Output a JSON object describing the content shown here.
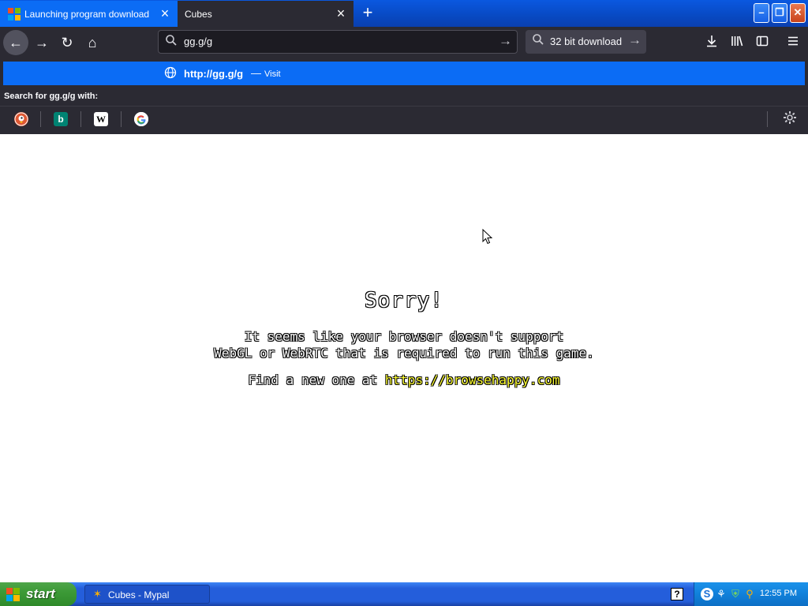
{
  "browser": {
    "tabs": [
      {
        "title": "Launching program download Wind",
        "active": true
      },
      {
        "title": "Cubes",
        "active": false
      }
    ],
    "new_tab_label": "+",
    "window_controls": {
      "minimize": "–",
      "restore": "❐",
      "close": "✕"
    },
    "nav": {
      "back": "←",
      "forward": "→",
      "reload": "↻",
      "home": "⌂"
    },
    "url_input_value": "gg.g/g",
    "search_bar_text": "32 bit download",
    "toolbar_icons": [
      "download-icon",
      "library-icon",
      "sidebar-icon",
      "menu-icon"
    ]
  },
  "dropdown": {
    "suggestion_url": "http://gg.g/g",
    "suggestion_sep": "—",
    "suggestion_action": "Visit",
    "search_with_label": "Search for gg.g/g with:",
    "engines": [
      "DuckDuckGo",
      "Bing",
      "Wikipedia",
      "Google"
    ]
  },
  "page": {
    "title": "Sorry!",
    "line1": "It seems like your browser doesn't support",
    "line2": "WebGL or WebRTC that is required to run this game.",
    "find_prefix": "Find a new one at ",
    "find_link": "https://browsehappy.com"
  },
  "taskbar": {
    "start_label": "start",
    "task_label": "Cubes - Mypal",
    "help_label": "?",
    "clock": "12:55 PM"
  },
  "colors": {
    "tab_active": "#0b6cf5",
    "toolbar": "#2b2a33",
    "highlight": "#0b6cf5",
    "link": "#ffff33",
    "taskbar": "#245edb",
    "start": "#3c9a37"
  }
}
